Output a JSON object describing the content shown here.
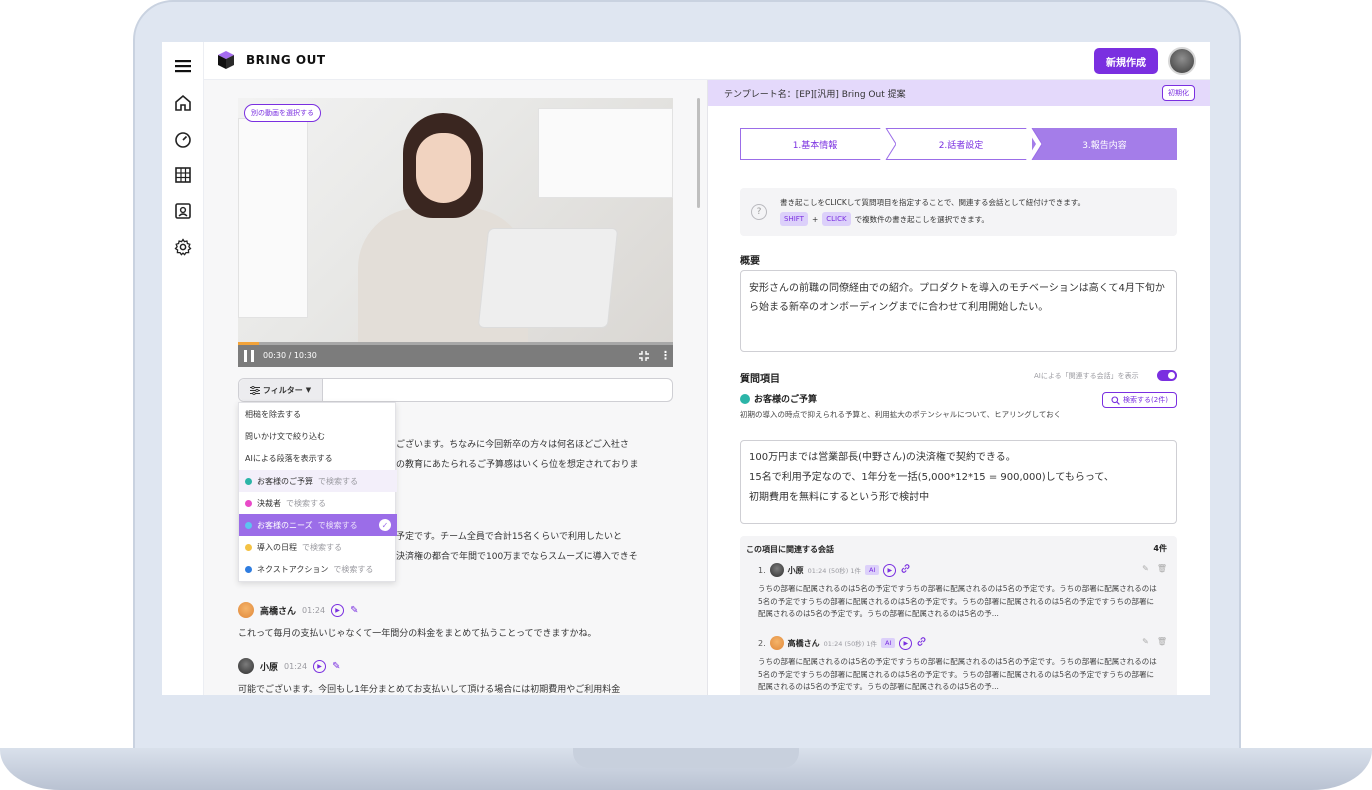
{
  "app": {
    "brand": "BRING OUT"
  },
  "header": {
    "new_button": "新規作成"
  },
  "video": {
    "select_other_label": "別の動画を選択する",
    "time": "00:30 / 10:30",
    "progress": 0.048
  },
  "filter": {
    "button_label": "フィルター",
    "menu": [
      {
        "label": "相槌を除去する"
      },
      {
        "label": "問いかけ文で絞り込む"
      },
      {
        "label": "AIによる段落を表示する"
      },
      {
        "label": "お客様のご予算",
        "sub": "で検索する",
        "color": "#2cb5a8"
      },
      {
        "label": "決裁者",
        "sub": "で検索する",
        "color": "#e94ac8"
      },
      {
        "label": "お客様のニーズ",
        "sub": "で検索する",
        "color": "#5cc4f0",
        "selected": true
      },
      {
        "label": "導入の日程",
        "sub": "で検索する",
        "color": "#f4c244"
      },
      {
        "label": "ネクストアクション",
        "sub": "で検索する",
        "color": "#2f7de0"
      }
    ]
  },
  "transcript": {
    "frag1_line1": "ございます。ちなみに今回新卒の方々は何名ほどご入社さ",
    "frag1_line2": "の教育にあたられるご予算感はいくら位を想定されておりま",
    "frag2_line1": "予定です。チーム全員で合計15名くらいで利用したいと",
    "frag2_line2": "決済権の都合で年間で100万までならスムーズに導入できそ",
    "entries": [
      {
        "speaker": "高橋さん",
        "time": "01:24",
        "text": "これって毎月の支払いじゃなくて一年間分の料金をまとめて払うことってできますかね。"
      },
      {
        "speaker": "小原",
        "time": "01:24",
        "text": "可能でございます。今回もし1年分まとめてお支払いして頂ける場合には初期費用やご利用料金"
      }
    ]
  },
  "template": {
    "name": "テンプレート名：[EP][汎用] Bring Out 提案",
    "reset": "初期化"
  },
  "steps": [
    "1.基本情報",
    "2.話者設定",
    "3.報告内容"
  ],
  "hint": {
    "line1": "書き起こしをCLICKして質問項目を指定することで、関連する会話として紐付けできます。",
    "key1": "SHIFT",
    "plus": "+",
    "key2": "CLICK",
    "line2": "で複数件の書き起こしを選択できます。"
  },
  "summary": {
    "title": "概要",
    "text": "安形さんの前職の同僚経由での紹介。プロダクトを導入のモチベーションは高くて4月下旬から始まる新卒のオンボーディングまでに合わせて利用開始したい。"
  },
  "questions": {
    "title": "質問項目",
    "ai_toggle_label": "AIによる「関連する会話」を表示",
    "item": {
      "title": "お客様のご予算",
      "desc": "初期の導入の時点で抑えられる予算と、利用拡大のポテンシャルについて、ヒアリングしておく",
      "search_label": "検索する(2件)",
      "answer_lines": [
        "100万円までは営業部長(中野さん)の決済権で契約できる。",
        "15名で利用予定なので、1年分を一括(5,000*12*15 = 900,000)してもらって、",
        "初期費用を無料にするという形で検討中"
      ]
    }
  },
  "related": {
    "title": "この項目に関連する会話",
    "count": "4件",
    "items": [
      {
        "num": "1.",
        "speaker": "小原",
        "meta": "01:24 (50秒) 1件",
        "ai": "AI",
        "text": "うちの部署に配属されるのは5名の予定ですうちの部署に配属されるのは5名の予定です。うちの部署に配属されるのは5名の予定ですうちの部署に配属されるのは5名の予定です。うちの部署に配属されるのは5名の予定ですうちの部署に配属されるのは5名の予定です。うちの部署に配属されるのは5名の予..."
      },
      {
        "num": "2.",
        "speaker": "高橋さん",
        "meta": "01:24 (50秒) 1件",
        "ai": "AI",
        "text": "うちの部署に配属されるのは5名の予定ですうちの部署に配属されるのは5名の予定です。うちの部署に配属されるのは5名の予定ですうちの部署に配属されるのは5名の予定です。うちの部署に配属されるのは5名の予定ですうちの部署に配属されるのは5名の予定です。うちの部署に配属されるのは5名の予..."
      }
    ]
  },
  "icons": {
    "rail": [
      "hamburger-icon",
      "home-icon",
      "dashboard-icon",
      "grid-icon",
      "contact-icon",
      "gear-icon"
    ]
  }
}
